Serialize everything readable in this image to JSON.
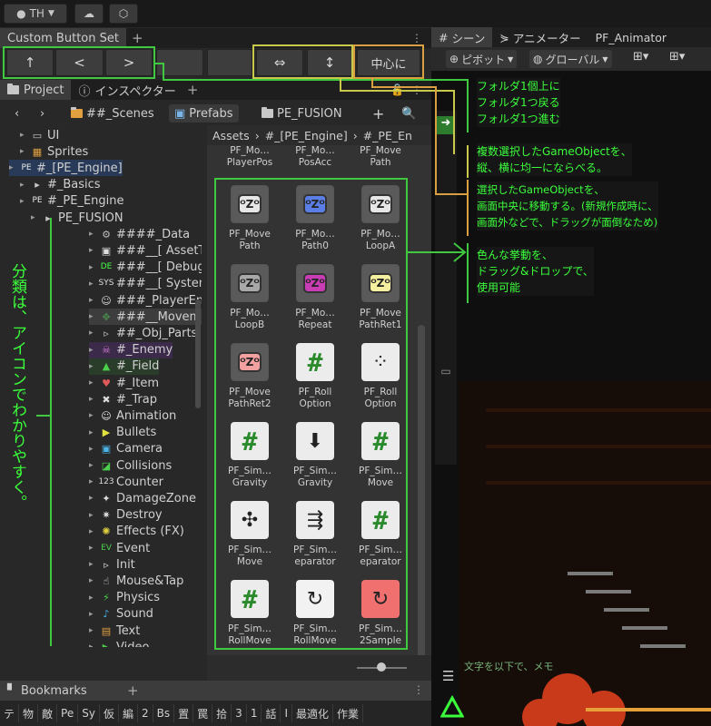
{
  "topbar": {
    "account": "TH",
    "cloud_icon": "cloud-icon",
    "collab_icon": "collab-icon"
  },
  "custom_button_set": {
    "tab": "Custom Button Set",
    "buttons": [
      "↑",
      "<",
      ">",
      "",
      "",
      "⇔",
      "↕",
      "中心に"
    ]
  },
  "project_tabs": {
    "project": "Project",
    "inspector": "インスペクター"
  },
  "breadcrumbs": [
    "##_Scenes",
    "Prefabs",
    "PE_FUSION"
  ],
  "asset_path": [
    "Assets",
    "#_[PE_Engine]",
    "#_PE_En"
  ],
  "tree": [
    {
      "label": "UI",
      "indent": 1
    },
    {
      "label": "Sprites",
      "indent": 1
    },
    {
      "label": "#_[PE_Engine]",
      "indent": 0
    },
    {
      "label": "#_Basics",
      "indent": 1
    },
    {
      "label": "#_PE_Engine",
      "indent": 1
    },
    {
      "label": "PE_FUSION",
      "indent": 2
    },
    {
      "label": "####_Data",
      "indent": 3
    },
    {
      "label": "###__[ AssetT",
      "indent": 3
    },
    {
      "label": "###__[ Debug -",
      "indent": 3
    },
    {
      "label": "###__[ System",
      "indent": 3
    },
    {
      "label": "###_PlayerEngi",
      "indent": 3
    },
    {
      "label": "###__Movements",
      "indent": 3
    },
    {
      "label": "##_Obj_Parts",
      "indent": 3
    },
    {
      "label": "#_Enemy",
      "indent": 3
    },
    {
      "label": "#_Field",
      "indent": 3
    },
    {
      "label": "#_Item",
      "indent": 3
    },
    {
      "label": "#_Trap",
      "indent": 3
    },
    {
      "label": "Animation",
      "indent": 3
    },
    {
      "label": "Bullets",
      "indent": 3
    },
    {
      "label": "Camera",
      "indent": 3
    },
    {
      "label": "Collisions",
      "indent": 3
    },
    {
      "label": "Counter",
      "indent": 3
    },
    {
      "label": "DamageZone",
      "indent": 3
    },
    {
      "label": "Destroy",
      "indent": 3
    },
    {
      "label": "Effects (FX)",
      "indent": 3
    },
    {
      "label": "Event",
      "indent": 3
    },
    {
      "label": "Init",
      "indent": 3
    },
    {
      "label": "Mouse&Tap",
      "indent": 3
    },
    {
      "label": "Physics",
      "indent": 3
    },
    {
      "label": "Sound",
      "indent": 3
    },
    {
      "label": "Text",
      "indent": 3
    },
    {
      "label": "Video",
      "indent": 3
    }
  ],
  "assets": [
    {
      "l1": "PF_Mo…",
      "l2": "PlayerPos",
      "kind": "none"
    },
    {
      "l1": "PF_Mo…",
      "l2": "PosAcc",
      "kind": "none"
    },
    {
      "l1": "PF_Move",
      "l2": "Path",
      "kind": "none"
    },
    {
      "l1": "PF_Move",
      "l2": "Path",
      "kind": "z",
      "color": "#e6e6e6"
    },
    {
      "l1": "PF_Mo…",
      "l2": "Path0",
      "kind": "z",
      "color": "#5a7de6"
    },
    {
      "l1": "PF_Mo…",
      "l2": "LoopA",
      "kind": "z",
      "color": "#e6e6e6"
    },
    {
      "l1": "PF_Mo…",
      "l2": "LoopB",
      "kind": "z",
      "color": "#a8a8a8"
    },
    {
      "l1": "PF_Mo…",
      "l2": "Repeat",
      "kind": "z",
      "color": "#c83cb4"
    },
    {
      "l1": "PF_Move",
      "l2": "PathRet1",
      "kind": "z",
      "color": "#f5f0a0"
    },
    {
      "l1": "PF_Move",
      "l2": "PathRet2",
      "kind": "z",
      "color": "#f2a0a0"
    },
    {
      "l1": "PF_Roll",
      "l2": "Option",
      "kind": "hash"
    },
    {
      "l1": "PF_Roll",
      "l2": "Option",
      "kind": "dots"
    },
    {
      "l1": "PF_Sim…",
      "l2": "Gravity",
      "kind": "hash"
    },
    {
      "l1": "PF_Sim…",
      "l2": "Gravity",
      "kind": "down"
    },
    {
      "l1": "PF_Sim…",
      "l2": "Move",
      "kind": "hash"
    },
    {
      "l1": "PF_Sim…",
      "l2": "Move",
      "kind": "cross"
    },
    {
      "l1": "PF_Sim…",
      "l2": "eparator",
      "kind": "sep"
    },
    {
      "l1": "PF_Sim…",
      "l2": "eparator",
      "kind": "hash"
    },
    {
      "l1": "PF_Sim…",
      "l2": "RollMove",
      "kind": "hash"
    },
    {
      "l1": "PF_Sim…",
      "l2": "RollMove",
      "kind": "rot",
      "color": "#f2f2f2"
    },
    {
      "l1": "PF_Sim…",
      "l2": "2Sample",
      "kind": "rot",
      "color": "#f07070"
    }
  ],
  "scene": {
    "tabs": [
      "シーン",
      "アニメーター",
      "PF_Animator"
    ],
    "pivot": "ピボット",
    "global": "グローバル",
    "bottom_text": "文字を以下で、メモ"
  },
  "annotations": {
    "nav": [
      "フォルダ1個上に",
      "フォルダ1つ戻る",
      "フォルダ1つ進む"
    ],
    "align": [
      "複数選択したGameObjectを、",
      "縦、横に均一にならべる。"
    ],
    "center": [
      "選択したGameObjectを、",
      "画面中央に移動する。(新規作成時に、",
      "画面外などで、ドラッグが面倒なため)"
    ],
    "dragdrop": [
      "色んな挙動を、",
      "ドラッグ&ドロップで、",
      "使用可能"
    ],
    "vertical": "分類は、アイコンでわかりやすく。"
  },
  "bookmarks": {
    "title": "Bookmarks",
    "items": [
      "テ",
      "物",
      "敵",
      "Pe",
      "Sy",
      "仮",
      "編",
      "2",
      "Bs",
      "置",
      "罠",
      "拾",
      "3",
      "1",
      "話",
      "I",
      "最適化",
      "作業"
    ]
  },
  "colors": {
    "annotation": "#3bff3b",
    "frame_green": "#40c840",
    "frame_yellow": "#c8c84a",
    "frame_orange": "#d8a040"
  }
}
